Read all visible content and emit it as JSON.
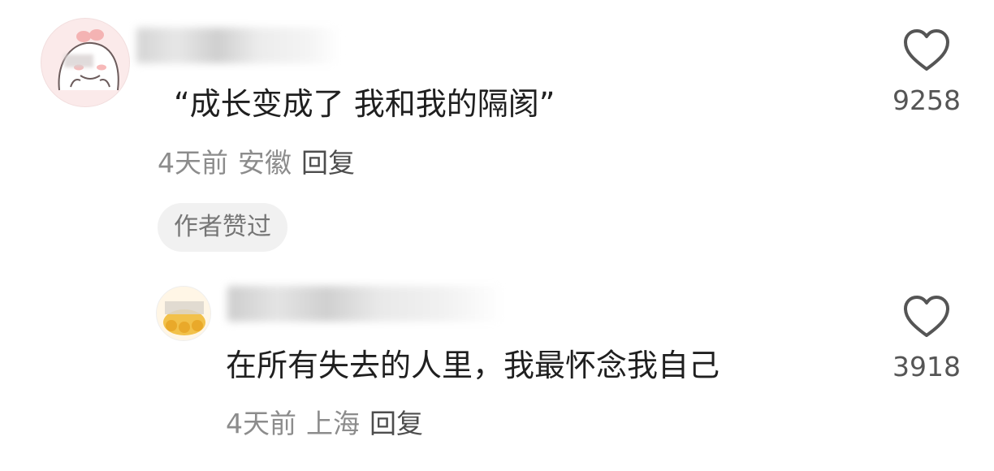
{
  "comments": [
    {
      "text": "“成长变成了 我和我的隔阂”",
      "time": "4天前",
      "location": "安徽",
      "reply_label": "回复",
      "badge": "作者赞过",
      "like_count": "9258"
    },
    {
      "text": "在所有失去的人里，我最怀念我自己",
      "time": "4天前",
      "location": "上海",
      "reply_label": "回复",
      "like_count": "3918"
    }
  ],
  "icons": {
    "like": "heart-outline-icon"
  },
  "colors": {
    "text_primary": "#1f1f1f",
    "text_muted": "#8c8c8c",
    "badge_bg": "#f1f1f1",
    "heart_stroke": "#555555"
  }
}
